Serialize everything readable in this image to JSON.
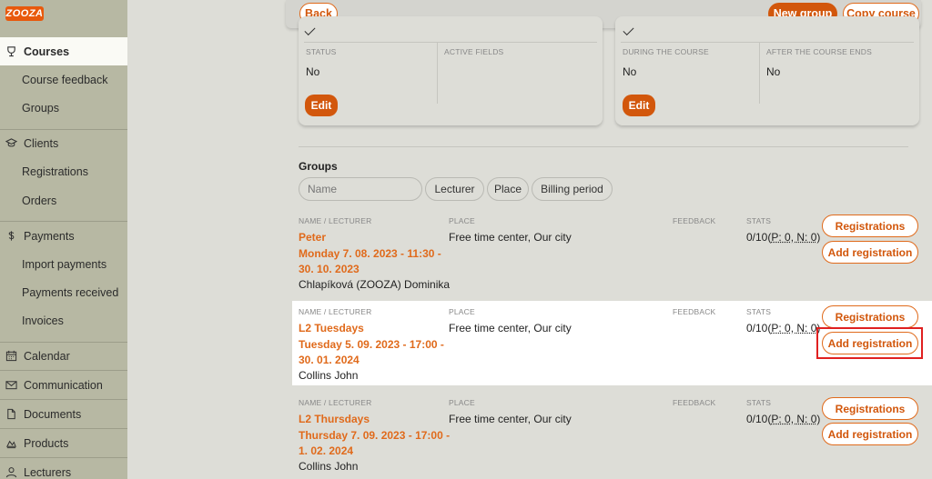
{
  "app": {
    "logo_text": "ZOOZA"
  },
  "sidebar": {
    "items": [
      {
        "label": "Courses",
        "icon": "trophy-icon",
        "level": "top",
        "active": true
      },
      {
        "label": "Course feedback",
        "level": "sub"
      },
      {
        "label": "Groups",
        "level": "sub"
      },
      {
        "label": "Clients",
        "icon": "graduation-cap-icon",
        "level": "top"
      },
      {
        "label": "Registrations",
        "level": "sub"
      },
      {
        "label": "Orders",
        "level": "sub"
      },
      {
        "label": "Payments",
        "icon": "dollar-icon",
        "level": "top"
      },
      {
        "label": "Import payments",
        "level": "sub"
      },
      {
        "label": "Payments received",
        "level": "sub"
      },
      {
        "label": "Invoices",
        "level": "sub"
      },
      {
        "label": "Calendar",
        "icon": "calendar-icon",
        "level": "top"
      },
      {
        "label": "Communication",
        "icon": "envelope-icon",
        "level": "top"
      },
      {
        "label": "Documents",
        "icon": "document-icon",
        "level": "top"
      },
      {
        "label": "Products",
        "icon": "products-icon",
        "level": "top"
      },
      {
        "label": "Lecturers",
        "icon": "user-icon",
        "level": "top"
      }
    ]
  },
  "toolbar": {
    "back_label": "Back",
    "new_group_label": "New group",
    "copy_course_label": "Copy course"
  },
  "card_left": {
    "col1_header": "STATUS",
    "col2_header": "ACTIVE FIELDS",
    "col1_value": "No",
    "col2_value": "",
    "edit_label": "Edit"
  },
  "card_right": {
    "col1_header": "DURING THE COURSE",
    "col2_header": "AFTER THE COURSE ENDS",
    "col1_value": "No",
    "col2_value": "No",
    "edit_label": "Edit"
  },
  "groups": {
    "title": "Groups",
    "filter_placeholder": "Name",
    "filters": [
      "Lecturer",
      "Place",
      "Billing period"
    ],
    "columns": {
      "name": "NAME / LECTURER",
      "place": "PLACE",
      "feedback": "FEEDBACK",
      "stats": "STATS"
    },
    "registrations_label": "Registrations",
    "add_registration_label": "Add registration",
    "rows": [
      {
        "title": "Peter",
        "date": "Monday 7. 08. 2023 - 11:30 - 30. 10. 2023",
        "lecturer": "Chlapíková (ZOOZA) Dominika",
        "place": "Free time center, Our city",
        "stats_count": "0/10",
        "stats_detail": "P: 0, N: 0"
      },
      {
        "title": "L2 Tuesdays",
        "date": "Tuesday 5. 09. 2023 - 17:00 - 30. 01. 2024",
        "lecturer": "Collins John",
        "place": "Free time center, Our city",
        "stats_count": "0/10",
        "stats_detail": "P: 0, N: 0"
      },
      {
        "title": "L2 Thursdays",
        "date": "Thursday 7. 09. 2023 - 17:00 - 1. 02. 2024",
        "lecturer": "Collins John",
        "place": "Free time center, Our city",
        "stats_count": "0/10",
        "stats_detail": "P: 0, N: 0"
      }
    ]
  },
  "colors": {
    "accent": "#d2570c",
    "sidebar_bg": "#b7b8a3",
    "content_bg": "#ddddd7",
    "highlight": "#e02020"
  }
}
